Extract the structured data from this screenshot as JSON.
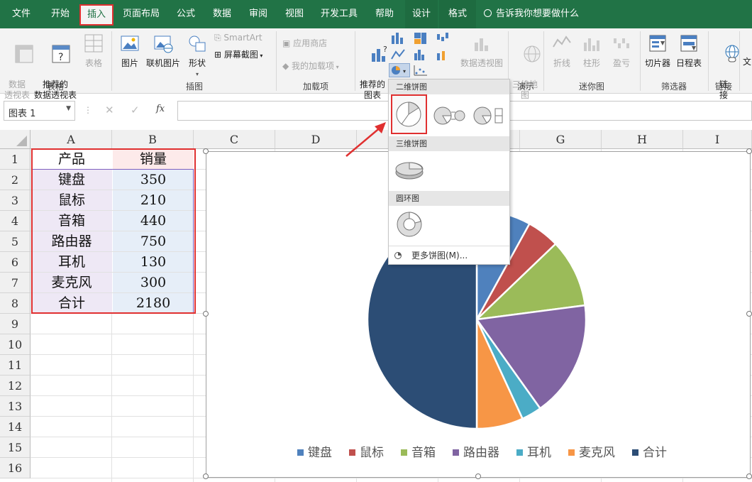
{
  "tabs": [
    "文件",
    "开始",
    "插入",
    "页面布局",
    "公式",
    "数据",
    "审阅",
    "视图",
    "开发工具",
    "帮助",
    "设计",
    "格式"
  ],
  "active_tab": "插入",
  "tell_me": "告诉我你想要做什么",
  "ribbon": {
    "pivot_table": "数据\n透视表",
    "recommended_pivot": "推荐的\n数据透视表",
    "table": "表格",
    "group_tables": "表格",
    "picture": "图片",
    "online_picture": "联机图片",
    "shapes": "形状",
    "smartart": "SmartArt",
    "screenshot": "屏幕截图",
    "group_illustrations": "插图",
    "app_store": "应用商店",
    "my_addins": "我的加载项",
    "group_addins": "加载项",
    "recommended_charts": "推荐的\n图表",
    "pivot_chart": "数据透视图",
    "map_3d": "三维地\n图",
    "group_tours": "演示",
    "spark_line": "折线",
    "spark_column": "柱形",
    "spark_winloss": "盈亏",
    "group_sparklines": "迷你图",
    "slicer": "切片器",
    "timeline": "日程表",
    "group_filters": "筛选器",
    "link": "链\n接",
    "group_links": "链接",
    "text_partial": "文"
  },
  "name_box": "图表 1",
  "fx": "fx",
  "columns": [
    "A",
    "B",
    "C",
    "D",
    "E",
    "F",
    "G",
    "H",
    "I"
  ],
  "rows": [
    "1",
    "2",
    "3",
    "4",
    "5",
    "6",
    "7",
    "8",
    "9",
    "10",
    "11",
    "12",
    "13",
    "14",
    "15",
    "16"
  ],
  "table": {
    "headers": [
      "产品",
      "销量"
    ],
    "rows": [
      [
        "键盘",
        "350"
      ],
      [
        "鼠标",
        "210"
      ],
      [
        "音箱",
        "440"
      ],
      [
        "路由器",
        "750"
      ],
      [
        "耳机",
        "130"
      ],
      [
        "麦克风",
        "300"
      ],
      [
        "合计",
        "2180"
      ]
    ]
  },
  "pie_dropdown": {
    "section_2d": "二维饼图",
    "section_3d": "三维饼图",
    "section_donut": "圆环图",
    "more": "更多饼图(M)..."
  },
  "chart_data": {
    "type": "pie",
    "categories": [
      "键盘",
      "鼠标",
      "音箱",
      "路由器",
      "耳机",
      "麦克风",
      "合计"
    ],
    "values": [
      350,
      210,
      440,
      750,
      130,
      300,
      2180
    ],
    "colors": [
      "#4f81bd",
      "#c0504d",
      "#9bbb59",
      "#8064a2",
      "#4bacc6",
      "#f79646",
      "#2c4d75"
    ],
    "legend": "bottom"
  }
}
